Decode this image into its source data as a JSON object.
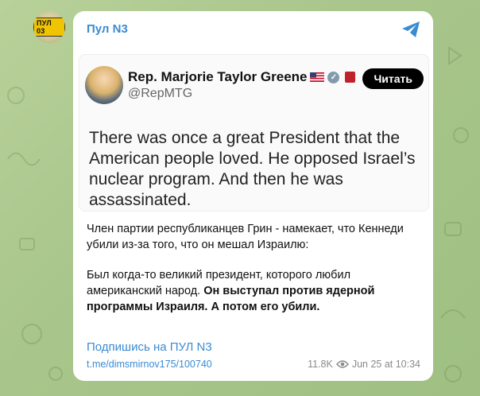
{
  "channel": {
    "avatar_plate": "ПУЛ 03",
    "name": "Пул N3"
  },
  "tweet": {
    "name": "Rep. Marjorie Taylor Greene",
    "handle": "@RepMTG",
    "read_label": "Читать",
    "text": "There was once a great President that the American people loved. He opposed Israel’s nuclear program. And then he was assassinated."
  },
  "post": {
    "paragraph1": "Член партии республиканцев Грин - намекает, что Кеннеди убили из-за того, что он мешал Израилю:",
    "paragraph2_plain": "Был когда-то великий президент, которого любил американский народ.",
    "paragraph2_bold": "Он выступал против ядерной программы Израиля. А потом его убили.",
    "subscribe": "Подпишись на ПУЛ N3",
    "url": "t.me/dimsmirnov175/100740",
    "views": "11.8K",
    "date": "Jun 25 at 10:34"
  },
  "colors": {
    "accent": "#3a8bd1",
    "background": "#a9c68c"
  }
}
